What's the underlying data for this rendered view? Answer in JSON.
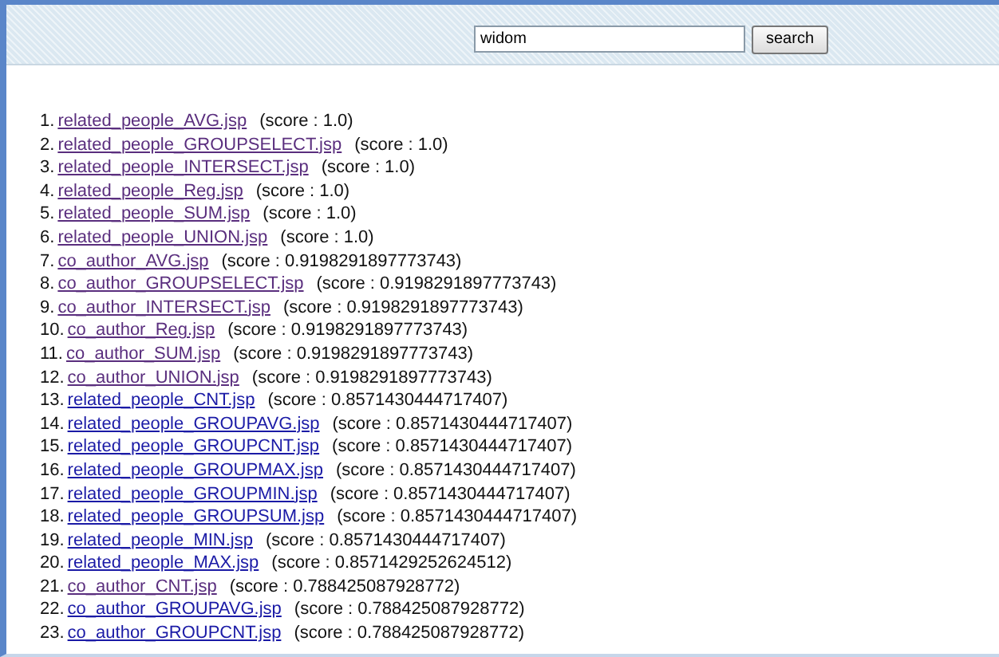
{
  "search": {
    "value": "widom",
    "button": "search"
  },
  "results": [
    {
      "rank": "1.",
      "link": "related_people_AVG.jsp",
      "score": "(score : 1.0)",
      "visited": true
    },
    {
      "rank": "2.",
      "link": "related_people_GROUPSELECT.jsp",
      "score": "(score : 1.0)",
      "visited": true
    },
    {
      "rank": "3.",
      "link": "related_people_INTERSECT.jsp",
      "score": "(score : 1.0)",
      "visited": true
    },
    {
      "rank": "4.",
      "link": "related_people_Reg.jsp",
      "score": "(score : 1.0)",
      "visited": true
    },
    {
      "rank": "5.",
      "link": "related_people_SUM.jsp",
      "score": "(score : 1.0)",
      "visited": true
    },
    {
      "rank": "6.",
      "link": "related_people_UNION.jsp",
      "score": "(score : 1.0)",
      "visited": true
    },
    {
      "rank": "7.",
      "link": "co_author_AVG.jsp",
      "score": "(score : 0.9198291897773743)",
      "visited": true
    },
    {
      "rank": "8.",
      "link": "co_author_GROUPSELECT.jsp",
      "score": "(score : 0.9198291897773743)",
      "visited": true
    },
    {
      "rank": "9.",
      "link": "co_author_INTERSECT.jsp",
      "score": "(score : 0.9198291897773743)",
      "visited": true
    },
    {
      "rank": "10.",
      "link": "co_author_Reg.jsp",
      "score": "(score : 0.9198291897773743)",
      "visited": true
    },
    {
      "rank": "11.",
      "link": "co_author_SUM.jsp",
      "score": "(score : 0.9198291897773743)",
      "visited": true
    },
    {
      "rank": "12.",
      "link": "co_author_UNION.jsp",
      "score": "(score : 0.9198291897773743)",
      "visited": true
    },
    {
      "rank": "13.",
      "link": "related_people_CNT.jsp",
      "score": "(score : 0.8571430444717407)",
      "visited": false
    },
    {
      "rank": "14.",
      "link": "related_people_GROUPAVG.jsp",
      "score": "(score : 0.8571430444717407)",
      "visited": false
    },
    {
      "rank": "15.",
      "link": "related_people_GROUPCNT.jsp",
      "score": "(score : 0.8571430444717407)",
      "visited": false
    },
    {
      "rank": "16.",
      "link": "related_people_GROUPMAX.jsp",
      "score": "(score : 0.8571430444717407)",
      "visited": false
    },
    {
      "rank": "17.",
      "link": "related_people_GROUPMIN.jsp",
      "score": "(score : 0.8571430444717407)",
      "visited": false
    },
    {
      "rank": "18.",
      "link": "related_people_GROUPSUM.jsp",
      "score": "(score : 0.8571430444717407)",
      "visited": false
    },
    {
      "rank": "19.",
      "link": "related_people_MIN.jsp",
      "score": "(score : 0.8571430444717407)",
      "visited": false
    },
    {
      "rank": "20.",
      "link": "related_people_MAX.jsp",
      "score": "(score : 0.8571429252624512)",
      "visited": false
    },
    {
      "rank": "21.",
      "link": "co_author_CNT.jsp",
      "score": "(score : 0.788425087928772)",
      "visited": true
    },
    {
      "rank": "22.",
      "link": "co_author_GROUPAVG.jsp",
      "score": "(score : 0.788425087928772)",
      "visited": false
    },
    {
      "rank": "23.",
      "link": "co_author_GROUPCNT.jsp",
      "score": "(score : 0.788425087928772)",
      "visited": false
    }
  ]
}
